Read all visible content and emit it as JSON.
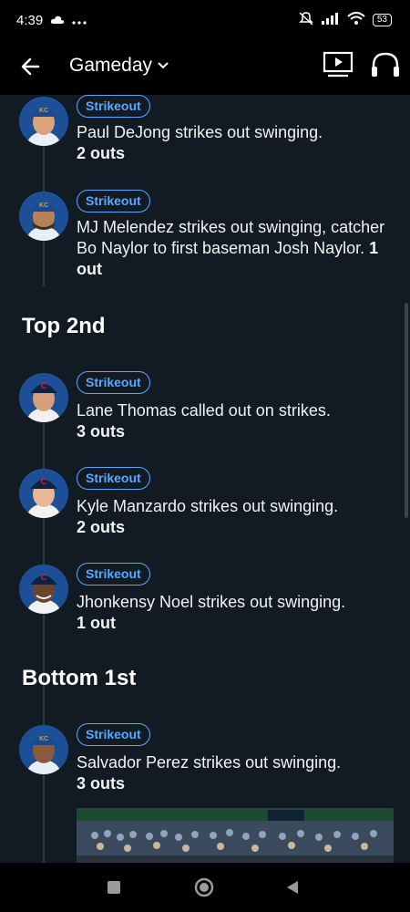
{
  "status_bar": {
    "time": "4:39",
    "battery": "53"
  },
  "app_bar": {
    "title": "Gameday"
  },
  "sections": {
    "top_2nd": "Top 2nd",
    "bottom_1st": "Bottom 1st"
  },
  "plays": [
    {
      "badge": "Strikeout",
      "text": "Paul DeJong strikes out swinging.",
      "outs": "2 outs",
      "team": "KC"
    },
    {
      "badge": "Strikeout",
      "text": "MJ Melendez strikes out swinging, catcher Bo Naylor to first baseman Josh Naylor.",
      "outs": "1 out",
      "team": "KC"
    },
    {
      "badge": "Strikeout",
      "text": "Lane Thomas called out on strikes.",
      "outs": "3 outs",
      "team": "C"
    },
    {
      "badge": "Strikeout",
      "text": "Kyle Manzardo strikes out swinging.",
      "outs": "2 outs",
      "team": "C"
    },
    {
      "badge": "Strikeout",
      "text": "Jhonkensy Noel strikes out swinging.",
      "outs": "1 out",
      "team": "C"
    },
    {
      "badge": "Strikeout",
      "text": "Salvador Perez strikes out swinging.",
      "outs": "3 outs",
      "team": "KC"
    }
  ],
  "colors": {
    "background": "#121a23",
    "badge_accent": "#5aa8ff",
    "timeline": "#2d3a48"
  }
}
